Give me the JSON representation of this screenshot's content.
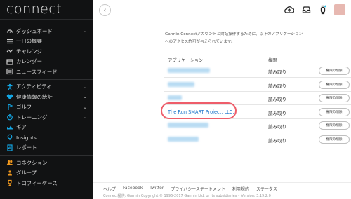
{
  "sidebar": {
    "logo": "connect",
    "items": [
      {
        "label": "ダッシュボード",
        "icon": "dashboard-icon",
        "chevron": "⌄",
        "color": "#d9d9d9"
      },
      {
        "label": "一日の概要",
        "icon": "list-icon",
        "chevron": "",
        "color": "#d9d9d9"
      },
      {
        "label": "チャレンジ",
        "icon": "challenge-icon",
        "chevron": "",
        "color": "#d9d9d9"
      },
      {
        "label": "カレンダー",
        "icon": "calendar-icon",
        "chevron": "",
        "color": "#d9d9d9"
      },
      {
        "label": "ニュースフィード",
        "icon": "newsfeed-icon",
        "chevron": "",
        "color": "#d9d9d9"
      },
      {
        "label": "アクティビティ",
        "icon": "activity-icon",
        "chevron": "⌄",
        "color": "#12a6e4"
      },
      {
        "label": "健康情報の統計",
        "icon": "heart-icon",
        "chevron": "⌄",
        "color": "#12a6e4"
      },
      {
        "label": "ゴルフ",
        "icon": "golf-icon",
        "chevron": "⌄",
        "color": "#12a6e4"
      },
      {
        "label": "トレーニング",
        "icon": "training-icon",
        "chevron": "⌄",
        "color": "#12a6e4"
      },
      {
        "label": "ギア",
        "icon": "gear-shoe-icon",
        "chevron": "",
        "color": "#12a6e4"
      },
      {
        "label": "Insights",
        "icon": "bulb-icon",
        "chevron": "",
        "color": "#12a6e4"
      },
      {
        "label": "レポート",
        "icon": "report-icon",
        "chevron": "",
        "color": "#12a6e4"
      },
      {
        "label": "コネクション",
        "icon": "people-icon",
        "chevron": "",
        "color": "#f39a1e"
      },
      {
        "label": "グループ",
        "icon": "group-icon",
        "chevron": "",
        "color": "#f39a1e"
      },
      {
        "label": "トロフィーケース",
        "icon": "trophy-icon",
        "chevron": "",
        "color": "#f39a1e"
      }
    ]
  },
  "header": {
    "back_glyph": "‹"
  },
  "content": {
    "desc": "Garmin Connectアカウントと対話操作するために、以下のアプリケーションへのアクセス許可が与えられています。",
    "col_app": "アプリケーション",
    "col_perm": "権限",
    "perm_text": "読み取り",
    "revoke_label": "権限の削除",
    "highlighted_app": "The Run SMART Project, LLC.",
    "rows": [
      {
        "name": "",
        "blur_width": 60
      },
      {
        "name": "",
        "blur_width": 38
      },
      {
        "name": "",
        "blur_width": 20
      },
      {
        "name": "The Run SMART Project, LLC.",
        "blur_width": 0
      },
      {
        "name": "",
        "blur_width": 58
      },
      {
        "name": "",
        "blur_width": 44
      }
    ]
  },
  "footer": {
    "links": [
      "ヘルプ",
      "Facebook",
      "Twitter",
      "プライバシーステートメント",
      "利用規約",
      "ステータス"
    ],
    "copyright": "Connect提供: Garmin Copyright © 1996-2017 Garmin Ltd. or its subsidiaries • Version: 3.19.2.0"
  },
  "colors": {
    "sidebar_bg": "#111213",
    "accent_blue": "#12a6e4",
    "accent_orange": "#f39a1e",
    "link_blue": "#1a73c9",
    "highlight_red": "#ee5d6a"
  }
}
